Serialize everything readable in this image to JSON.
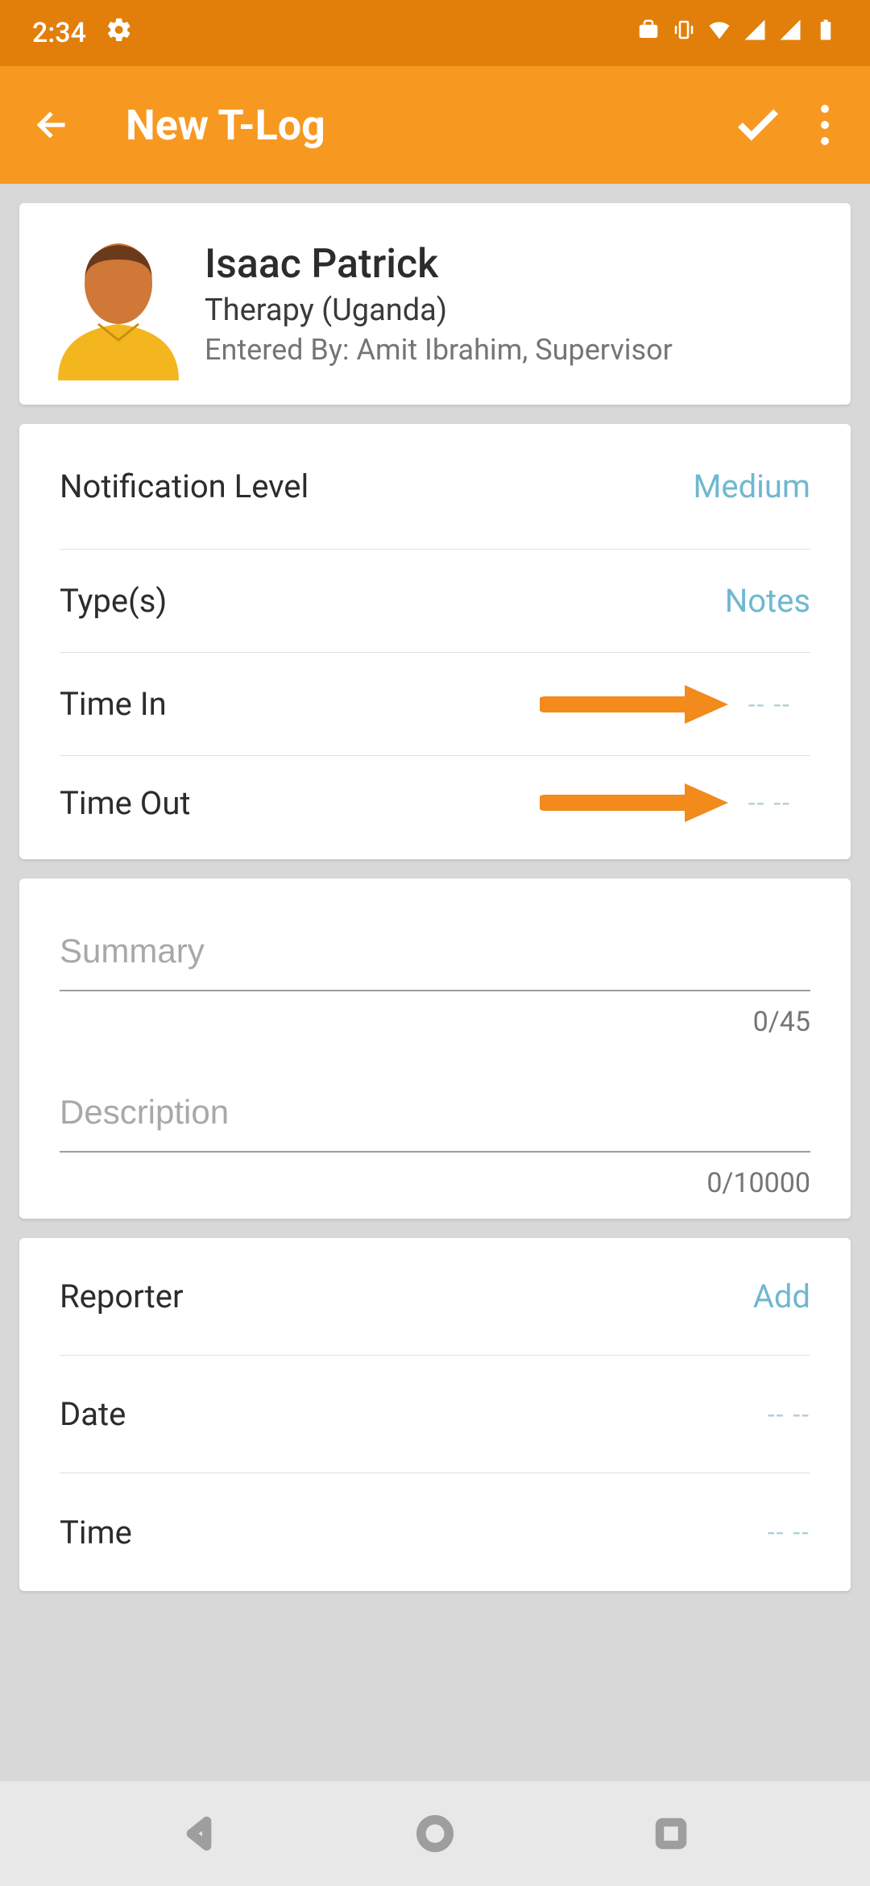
{
  "status": {
    "time": "2:34"
  },
  "header": {
    "title": "New T-Log"
  },
  "person": {
    "name": "Isaac Patrick",
    "subtitle": "Therapy (Uganda)",
    "entered_by": "Entered By: Amit Ibrahim, Supervisor"
  },
  "fields": {
    "notification_label": "Notification Level",
    "notification_value": "Medium",
    "types_label": "Type(s)",
    "types_value": "Notes",
    "time_in_label": "Time In",
    "time_in_value": "-- --",
    "time_out_label": "Time Out",
    "time_out_value": "-- --"
  },
  "text": {
    "summary_placeholder": "Summary",
    "summary_counter": "0/45",
    "description_placeholder": "Description",
    "description_counter": "0/10000"
  },
  "bottom": {
    "reporter_label": "Reporter",
    "reporter_action": "Add",
    "date_label": "Date",
    "date_value": "-- --",
    "time_label": "Time",
    "time_value": "-- --"
  },
  "colors": {
    "status_bg": "#e27f0a",
    "appbar_bg": "#f79921",
    "link": "#6fb8cf",
    "arrow": "#f28a1c"
  }
}
